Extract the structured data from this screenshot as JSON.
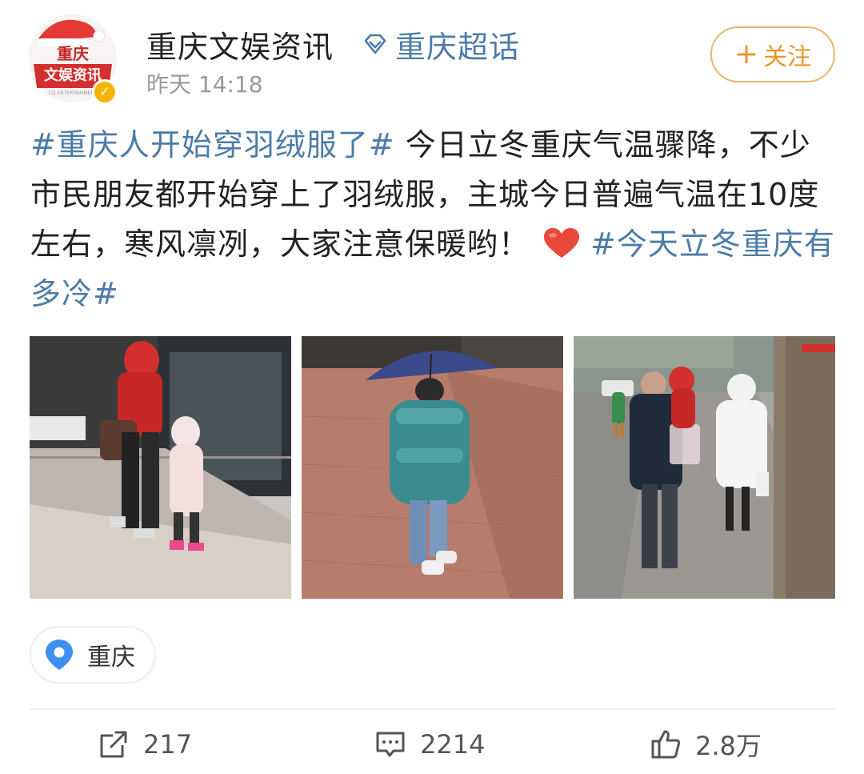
{
  "header": {
    "user_name": "重庆文娱资讯",
    "super_topic": "重庆超话",
    "post_time": "昨天 14:18",
    "follow_button": "关注",
    "avatar_text_top": "重庆",
    "avatar_text_bottom": "文娱资讯",
    "avatar_text_small": "CQ ENTERTAINMENT"
  },
  "post": {
    "hashtag_1": "#重庆人开始穿羽绒服了#",
    "body_1": " 今日立冬重庆气温骤降，不少市民朋友都开始穿上了羽绒服，主城今日普遍气温在10度左右，寒风凛冽，大家注意保暖哟！",
    "hashtag_2": "#今天立冬重庆有多冷#"
  },
  "location": {
    "label": "重庆"
  },
  "actions": {
    "reposts": "217",
    "comments": "2214",
    "likes": "2.8万"
  },
  "colors": {
    "link": "#4d7ba8",
    "follow": "#e8962a",
    "verified": "#f4b400",
    "heart": "#e8483a",
    "pin": "#3f8ff0"
  }
}
